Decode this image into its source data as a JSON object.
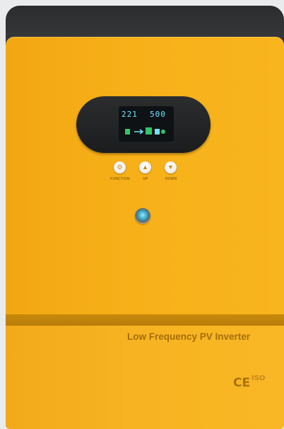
{
  "device": {
    "display": {
      "left_reading": "221",
      "right_reading": "500"
    },
    "buttons": [
      {
        "label": "FUNCTION",
        "icon": "gear-icon"
      },
      {
        "label": "UP",
        "icon": "arrow-up-icon"
      },
      {
        "label": "DOWN",
        "icon": "arrow-down-icon"
      }
    ],
    "product_name": "Low Frequency PV Inverter",
    "ce_mark": "CE",
    "iso_mark": "ISO",
    "colors": {
      "body": "#f7b018",
      "cap": "#2f3133",
      "stripe": "#c0840a",
      "display": "#6fe3ff"
    }
  }
}
